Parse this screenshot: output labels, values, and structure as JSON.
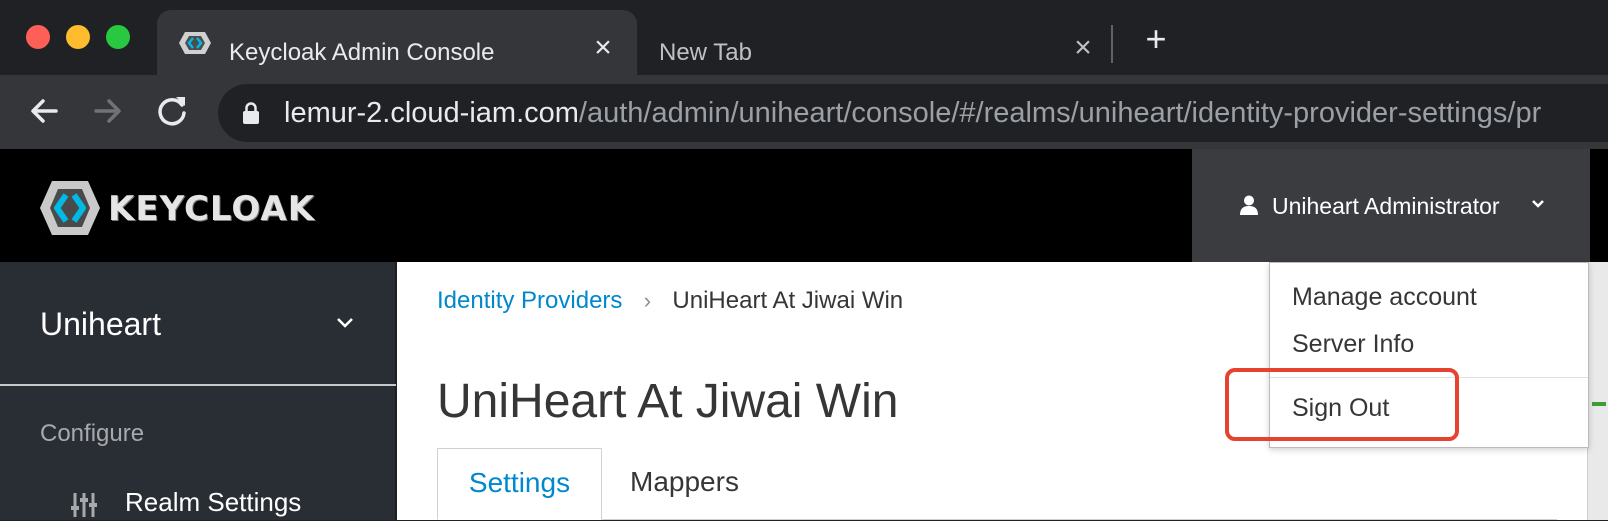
{
  "browser": {
    "tabs": [
      {
        "title": "Keycloak Admin Console",
        "active": true
      },
      {
        "title": "New Tab",
        "active": false
      }
    ],
    "close_glyph": "×",
    "new_tab_glyph": "+",
    "url_host": "lemur-2.cloud-iam.com",
    "url_path": "/auth/admin/uniheart/console/#/realms/uniheart/identity-provider-settings/pr"
  },
  "header": {
    "logo_text": "KEYCLOAK",
    "user_name": "Uniheart Administrator"
  },
  "sidebar": {
    "realm": "Uniheart",
    "section_label": "Configure",
    "items": [
      {
        "label": "Realm Settings",
        "icon": "sliders-icon"
      }
    ]
  },
  "main": {
    "breadcrumb": {
      "link": "Identity Providers",
      "separator": "›",
      "current": "UniHeart At Jiwai Win"
    },
    "title": "UniHeart At Jiwai Win",
    "tabs": [
      {
        "label": "Settings",
        "active": true
      },
      {
        "label": "Mappers",
        "active": false
      }
    ]
  },
  "user_menu": {
    "items": [
      "Manage account",
      "Server Info",
      "Sign Out"
    ]
  },
  "colors": {
    "link_blue": "#0088ce",
    "highlight_red": "#e5432f",
    "header_black": "#000000",
    "sidebar_dark": "#292e34"
  }
}
